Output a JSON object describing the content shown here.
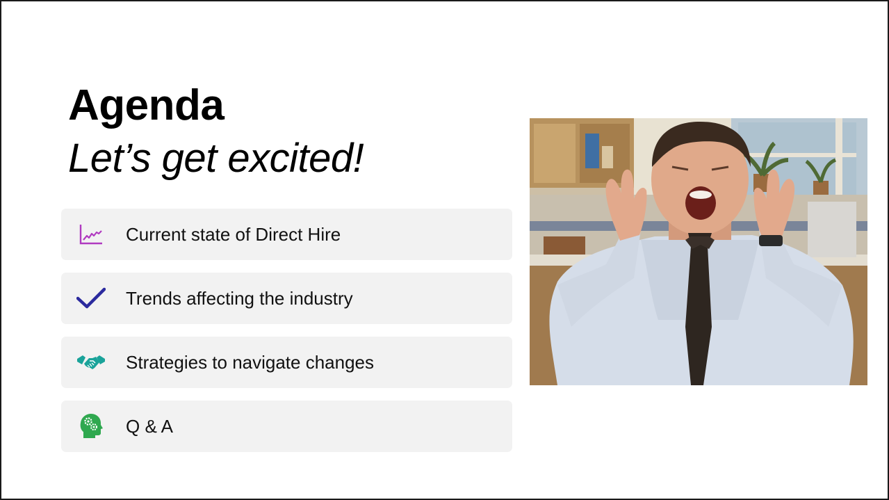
{
  "slide": {
    "title": "Agenda",
    "subtitle": "Let’s get excited!",
    "agenda": [
      {
        "label": "Current state of Direct Hire",
        "icon": "trend-chart-icon",
        "color": "#b03ac0"
      },
      {
        "label": "Trends affecting the industry",
        "icon": "checkmark-icon",
        "color": "#2b2a9e"
      },
      {
        "label": "Strategies to navigate changes",
        "icon": "handshake-icon",
        "color": "#1aa39a"
      },
      {
        "label": "Q & A",
        "icon": "head-gears-icon",
        "color": "#2fa84f"
      }
    ],
    "photo": {
      "icon": "excited-man-photo"
    }
  }
}
